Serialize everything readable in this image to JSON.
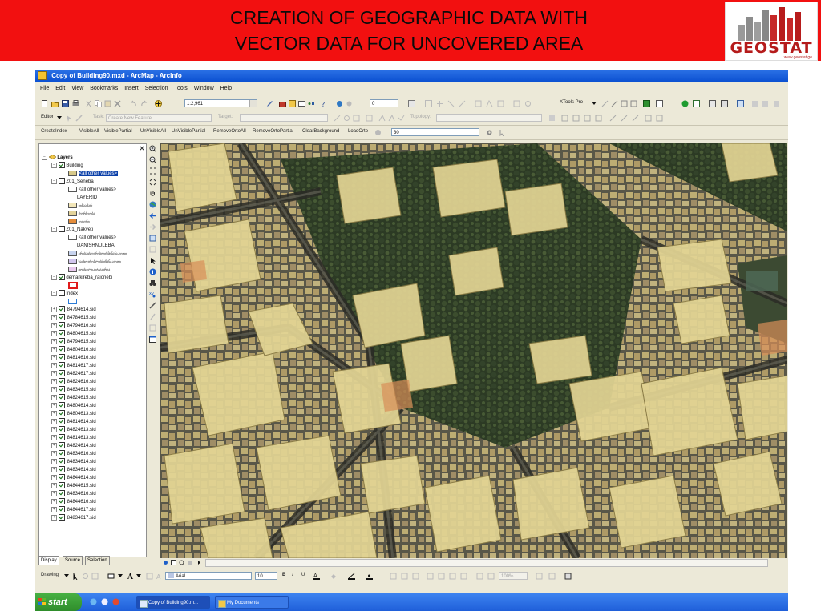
{
  "slide": {
    "title_line1": "CREATION OF GEOGRAPHIC DATA WITH",
    "title_line2": "VECTOR DATA FOR UNCOVERED AREA",
    "logo_text": "GEOSTAT",
    "logo_url": "www.geostat.ge",
    "banner_color": "#f21010"
  },
  "window": {
    "title": "Copy of Building90.mxd - ArcMap - ArcInfo",
    "menu": [
      "File",
      "Edit",
      "View",
      "Bookmarks",
      "Insert",
      "Selection",
      "Tools",
      "Window",
      "Help"
    ]
  },
  "standard_toolbar": {
    "scale_value": "1:2,961",
    "combo_value": "0",
    "xtools_label": "XTools Pro"
  },
  "editor_toolbar": {
    "editor_label": "Editor",
    "task_label": "Task:",
    "task_value": "Create New Feature",
    "target_label": "Target:",
    "target_value": "",
    "topology_label": "Topology:"
  },
  "custom_toolbar": {
    "buttons": [
      "CreateIndex",
      "VisibleAll",
      "VisiblePartial",
      "UnVisibleAll",
      "UnVisiblePartial",
      "RemoveOrtoAll",
      "RemoveOrtoPartial",
      "ClearBackground",
      "LoadOrto"
    ],
    "value": "30"
  },
  "toc": {
    "root": "Layers",
    "building_layer": "Building",
    "building_value": "<all other values>",
    "seneba_layer": "Z01_Seneba",
    "seneba_value": "<all other values>",
    "seneba_field": "LAYERID",
    "seneba_classes": [
      "ბინაამარ",
      "მეურნეობა",
      "ბეტონი"
    ],
    "nakveti_layer": "Z01_Nakveti",
    "nakveti_value": "<all other values>",
    "nakveti_field": "DANISHNULEBA",
    "nakveti_classes": [
      "არასაცხოვრებლისმიწანაკვეთი",
      "საცხოვრებლისმიწანაკვეთი",
      "ცოცხალიკატეგორია"
    ],
    "demarkireba_layer": "demarkireba_raionebi",
    "index_layer": "Index",
    "sid_files": [
      "84794614.sid",
      "84784615.sid",
      "84794616.sid",
      "84804615.sid",
      "84794615.sid",
      "84804616.sid",
      "84814616.sid",
      "84814617.sid",
      "84824617.sid",
      "84824616.sid",
      "84834615.sid",
      "84824615.sid",
      "84804614.sid",
      "84804613.sid",
      "84814614.sid",
      "84824613.sid",
      "84814613.sid",
      "84824614.sid",
      "84834616.sid",
      "84834614.sid",
      "84834614.sid",
      "84844614.sid",
      "84844615.sid",
      "84834616.sid",
      "84844616.sid",
      "84844617.sid",
      "84834617.sid"
    ],
    "tabs": [
      "Display",
      "Source",
      "Selection"
    ]
  },
  "draw_toolbar": {
    "drawing_label": "Drawing",
    "font_value": "Arial",
    "size_value": "10",
    "bold": "B",
    "italic": "I",
    "underline": "U",
    "zoom_value": "100%"
  },
  "taskbar": {
    "start_label": "start",
    "tasks": [
      "Copy of Building90.m...",
      "My Documents"
    ]
  },
  "colors": {
    "titlebar": "#0a4fd0",
    "chrome": "#ece9d8",
    "building_fill": "#d7c98a",
    "seneba_1": "#f2e6b8",
    "seneba_2": "#e3d39a",
    "seneba_3": "#e48c3a",
    "nakveti_1": "#c8d4ee",
    "nakveti_2": "#d2c6ee",
    "nakveti_3": "#e9c9ee"
  }
}
